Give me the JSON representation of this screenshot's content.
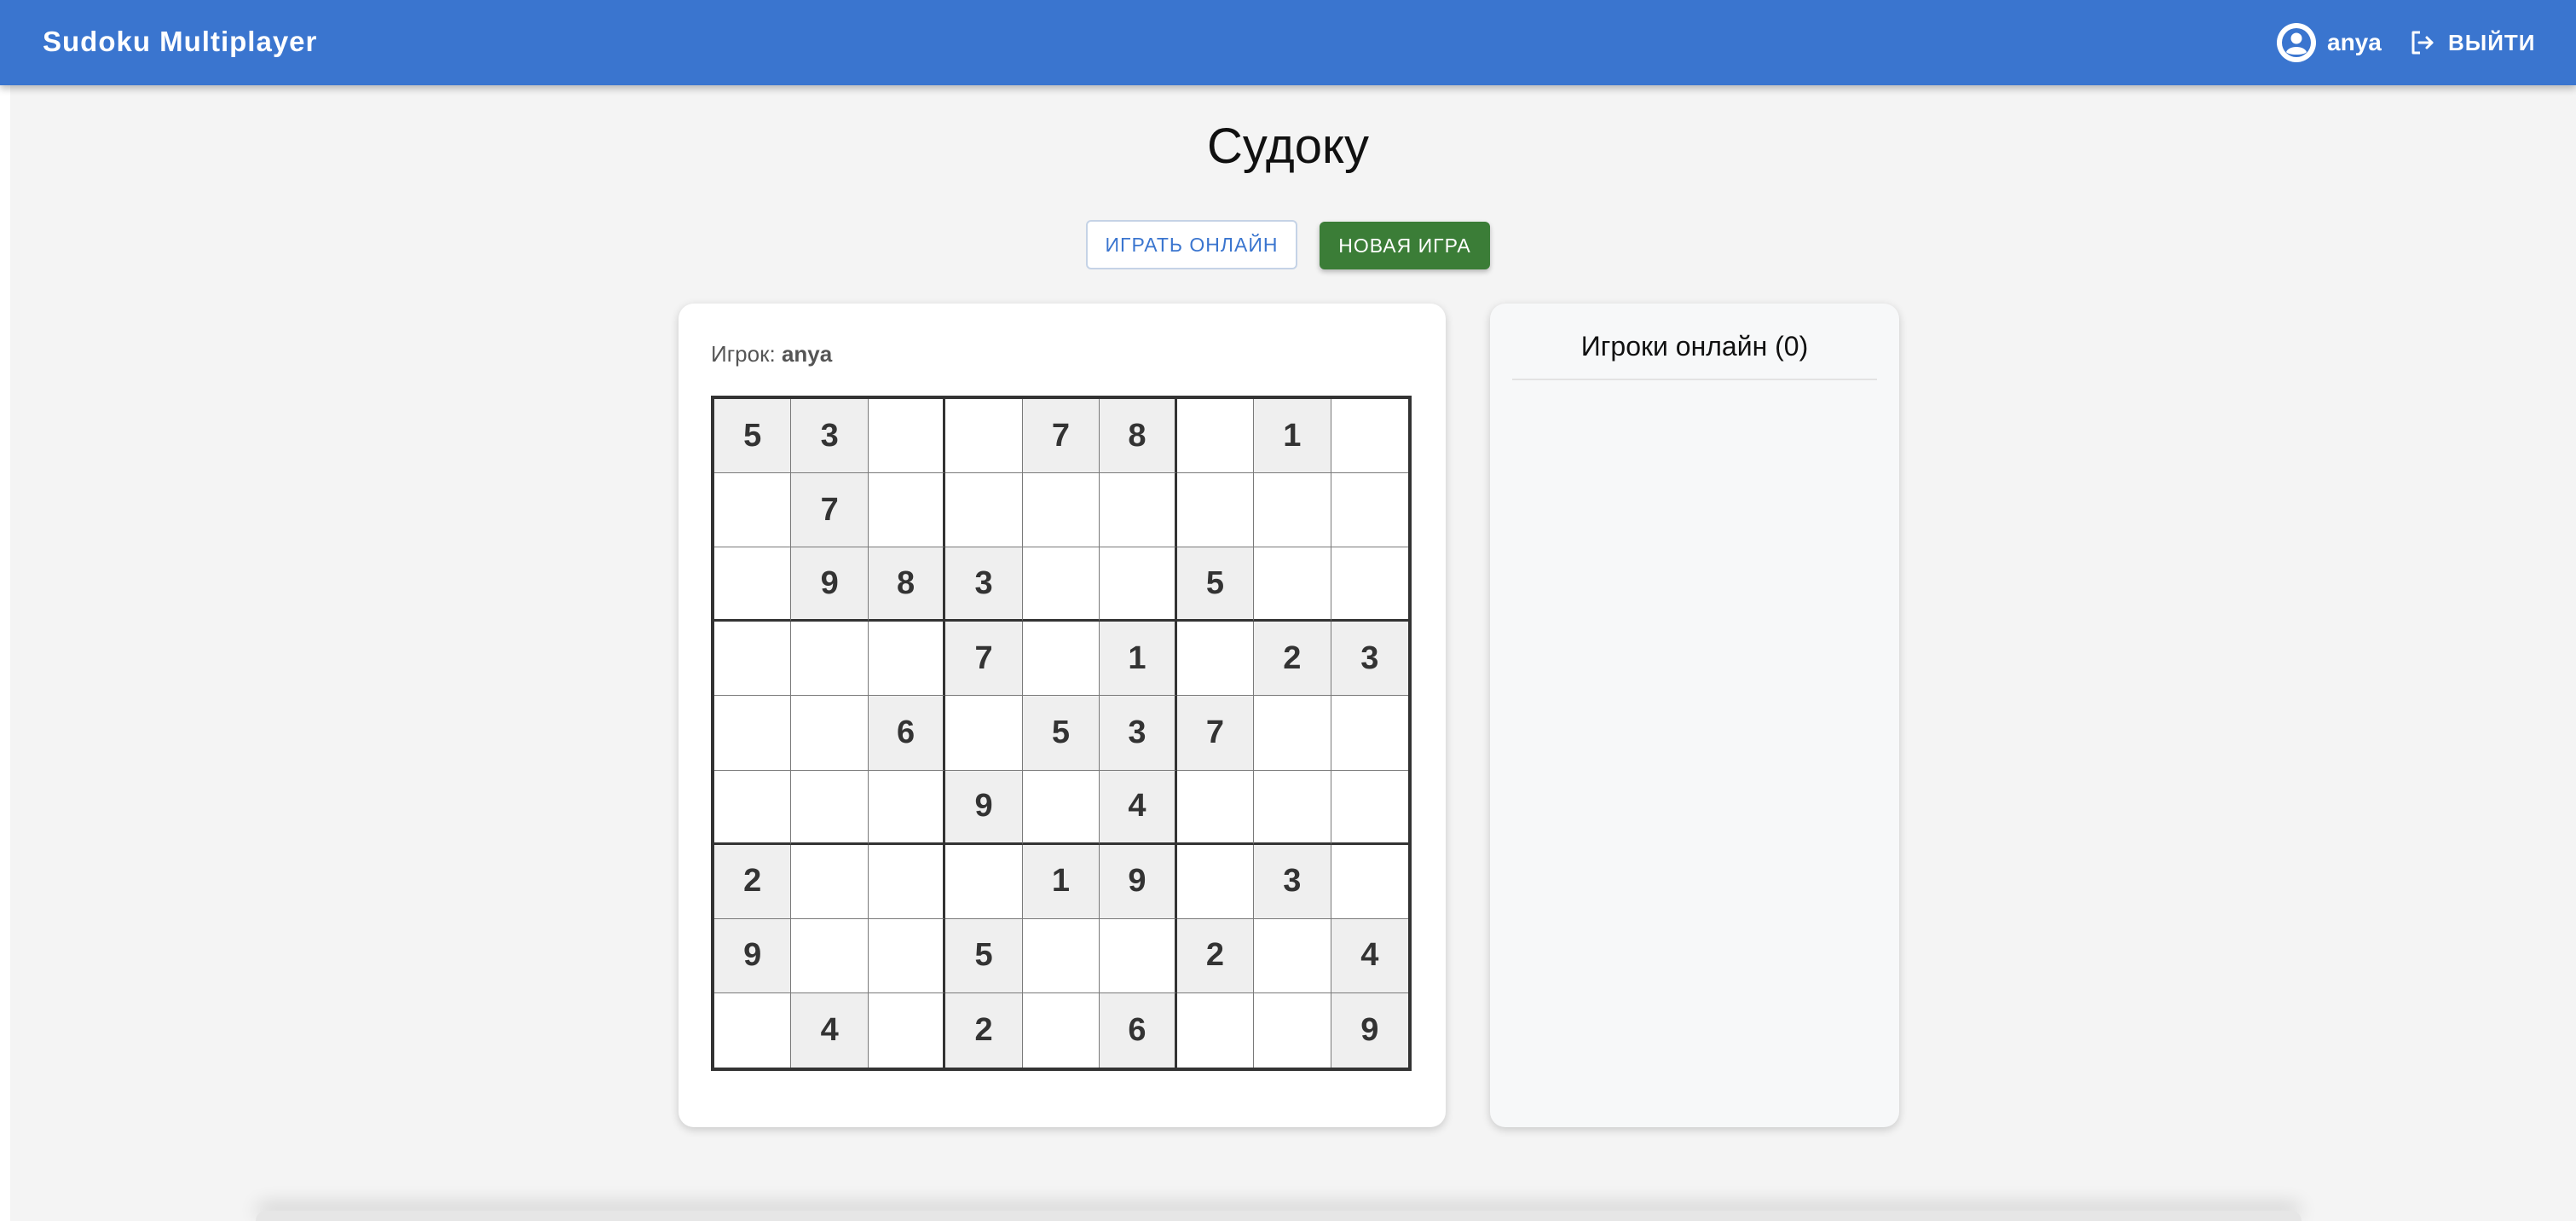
{
  "app": {
    "brand": "Sudoku Multiplayer",
    "username": "anya",
    "logout_label": "ВЫЙТИ",
    "accent_color": "#3a75cf"
  },
  "page": {
    "title": "Судоку"
  },
  "actions": {
    "play_online": "ИГРАТЬ ОНЛАЙН",
    "new_game": "НОВАЯ ИГРА"
  },
  "game": {
    "player_label": "Игрок:",
    "player_name": "anya",
    "board": [
      [
        "5",
        "3",
        "",
        "",
        "7",
        "8",
        "",
        "1",
        ""
      ],
      [
        "",
        "7",
        "",
        "",
        "",
        "",
        "",
        "",
        ""
      ],
      [
        "",
        "9",
        "8",
        "3",
        "",
        "",
        "5",
        "",
        ""
      ],
      [
        "",
        "",
        "",
        "7",
        "",
        "1",
        "",
        "2",
        "3"
      ],
      [
        "",
        "",
        "6",
        "",
        "5",
        "3",
        "7",
        "",
        ""
      ],
      [
        "",
        "",
        "",
        "9",
        "",
        "4",
        "",
        "",
        ""
      ],
      [
        "2",
        "",
        "",
        "",
        "1",
        "9",
        "",
        "3",
        ""
      ],
      [
        "9",
        "",
        "",
        "5",
        "",
        "",
        "2",
        "",
        "4"
      ],
      [
        "",
        "4",
        "",
        "2",
        "",
        "6",
        "",
        "",
        "9"
      ]
    ]
  },
  "players_panel": {
    "title": "Игроки онлайн (0)"
  },
  "icons": {
    "user": "account-circle-icon",
    "logout": "logout-icon"
  }
}
